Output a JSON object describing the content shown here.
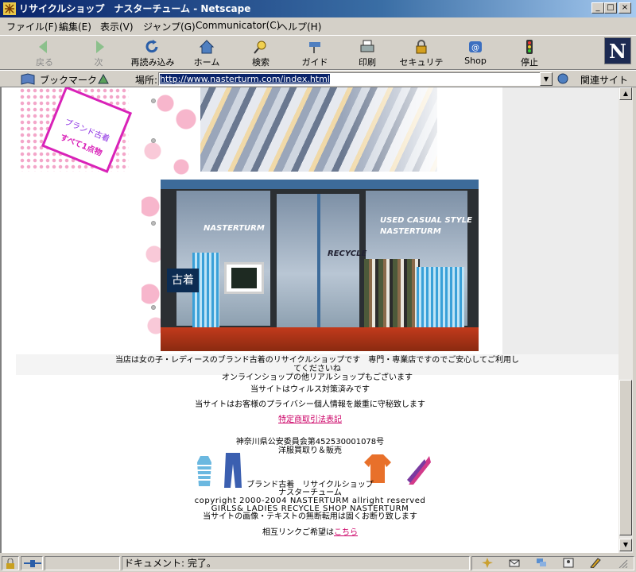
{
  "window": {
    "title": "リサイクルショップ　ナスターチューム - Netscape"
  },
  "menu": {
    "file": "ファイル(F)",
    "edit": "編集(E)",
    "view": "表示(V)",
    "jump": "ジャンプ(G)",
    "communicator": "Communicator(C)",
    "help": "ヘルプ(H)"
  },
  "toolbar": {
    "back": "戻る",
    "forward": "次",
    "reload": "再読み込み",
    "home": "ホーム",
    "search": "検索",
    "guide": "ガイド",
    "print": "印刷",
    "security": "セキュリティ",
    "shop": "Shop",
    "stop": "停止"
  },
  "location": {
    "bookmarks": "ブックマーク",
    "label": "場所:",
    "url": "http://www.nasterturm.com/index.html",
    "related": "関連サイト"
  },
  "page": {
    "tag_line1": "ブランド古着",
    "tag_line2": "すべて1点物",
    "sign": "古着",
    "door_sign": "NASTERTURM",
    "door_sign2": "USED CASUAL STYLE",
    "door_text": "RECYCLE",
    "notice_line1": "当店は女の子・レディースのブランド古着のリサイクルショップです　専門・専業店ですのでご安心してご利用してくださいね",
    "notice_line2": "オンラインショップの他リアルショップもございます",
    "virus": "当サイトはウィルス対策済みです",
    "privacy": "当サイトはお客様のプライバシー個人情報を厳重に守秘致します",
    "law_link": "特定商取引法表記",
    "license": "神奈川県公安委員会第452530001078号",
    "license2": "洋服買取り＆販売",
    "shop_name": "ブランド古着　リサイクルショップ",
    "shop_name2": "ナスターチューム",
    "copyright": "copyright 2000-2004 NASTERTURM allright reserved",
    "copyright2": "GIRLS& LADIES RECYCLE SHOP NASTERTURM",
    "copyright3": "当サイトの画像・テキストの無断転用は固くお断り致します",
    "links_text": "相互リンクご希望は",
    "links_link": "こちら"
  },
  "status": {
    "text": "ドキュメント: 完了。"
  },
  "colors": {
    "link": "#cc0066",
    "titlebar": "#0a246a",
    "tag_border": "#d922b8"
  }
}
